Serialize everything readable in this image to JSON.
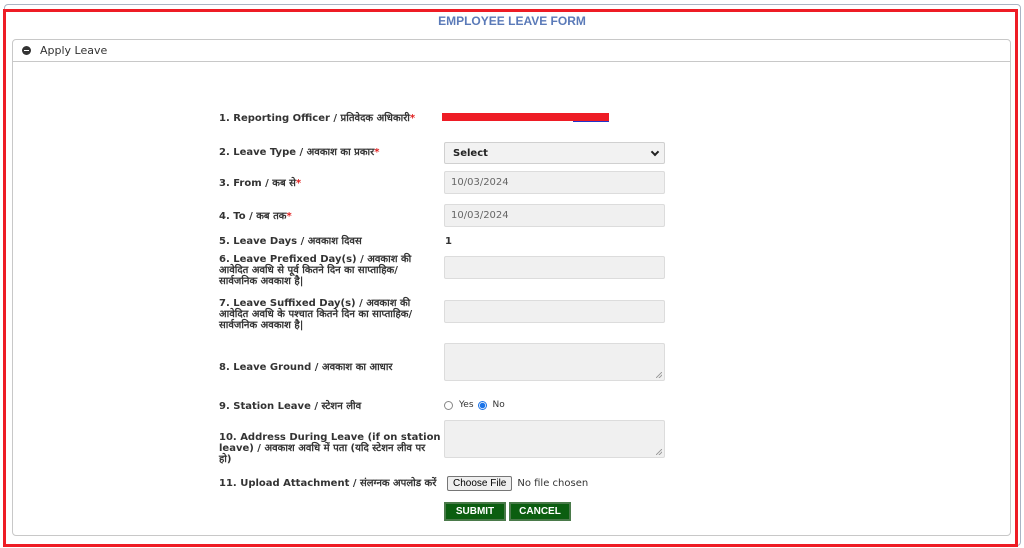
{
  "page": {
    "title": "EMPLOYEE LEAVE FORM"
  },
  "panel": {
    "header": "Apply Leave",
    "header_icon": "minus-circle-icon"
  },
  "form": {
    "required_mark": "*",
    "fields": [
      {
        "label": "1. Reporting Officer / प्रतिवेदक अधिकारी",
        "required": true,
        "value": "[redacted]"
      },
      {
        "label": "2. Leave Type / अवकाश का प्रकार",
        "required": true,
        "value": "Select"
      },
      {
        "label": "3. From / कब से",
        "required": true,
        "value": "10/03/2024"
      },
      {
        "label": "4. To / कब तक",
        "required": true,
        "value": "10/03/2024"
      },
      {
        "label": "5. Leave Days / अवकाश दिवस",
        "required": false,
        "value": "1"
      },
      {
        "label": "6. Leave Prefixed Day(s) / अवकाश की आवेदित अवधि से पूर्व कितने दिन का साप्ताहिक/सार्वजनिक अवकाश है|",
        "required": false,
        "value": ""
      },
      {
        "label": "7. Leave Suffixed Day(s) / अवकाश की आवेदित अवधि के पश्चात कितने दिन का साप्ताहिक/सार्वजनिक अवकाश है|",
        "required": false,
        "value": ""
      },
      {
        "label": "8. Leave Ground / अवकाश का आधार",
        "required": false,
        "value": ""
      },
      {
        "label": "9. Station Leave / स्टेशन लीव",
        "required": false,
        "options": [
          "Yes",
          "No"
        ],
        "selected": "No"
      },
      {
        "label": "10. Address During Leave (if on station leave) / अवकाश अवधि में पता (यदि स्टेशन लीव पर हो)",
        "required": false,
        "value": ""
      },
      {
        "label": "11. Upload Attachment / संलग्नक अपलोड करें",
        "required": false,
        "button": "Choose File",
        "status": "No file chosen"
      }
    ]
  },
  "actions": {
    "submit": "SUBMIT",
    "cancel": "CANCEL"
  },
  "colors": {
    "title": "#5a7ab8",
    "button_bg": "#0b5e10",
    "required": "#e02020",
    "highlight_frame": "#ee1c25"
  }
}
